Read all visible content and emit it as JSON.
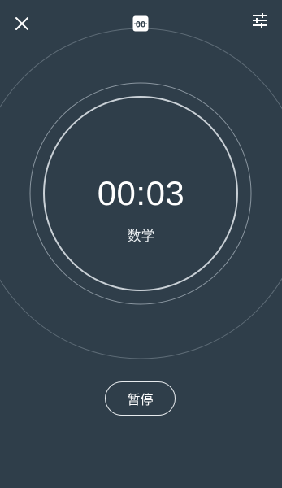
{
  "header": {
    "close_icon": "close-icon",
    "mode_icon": "timer-mode-icon",
    "mode_icon_text": "00",
    "settings_icon": "sliders-icon"
  },
  "timer": {
    "time": "00:03",
    "subject": "数学"
  },
  "controls": {
    "pause_label": "暂停"
  },
  "colors": {
    "background": "#2f3e4a",
    "ring": "#c9d0d6",
    "text": "#ffffff"
  }
}
